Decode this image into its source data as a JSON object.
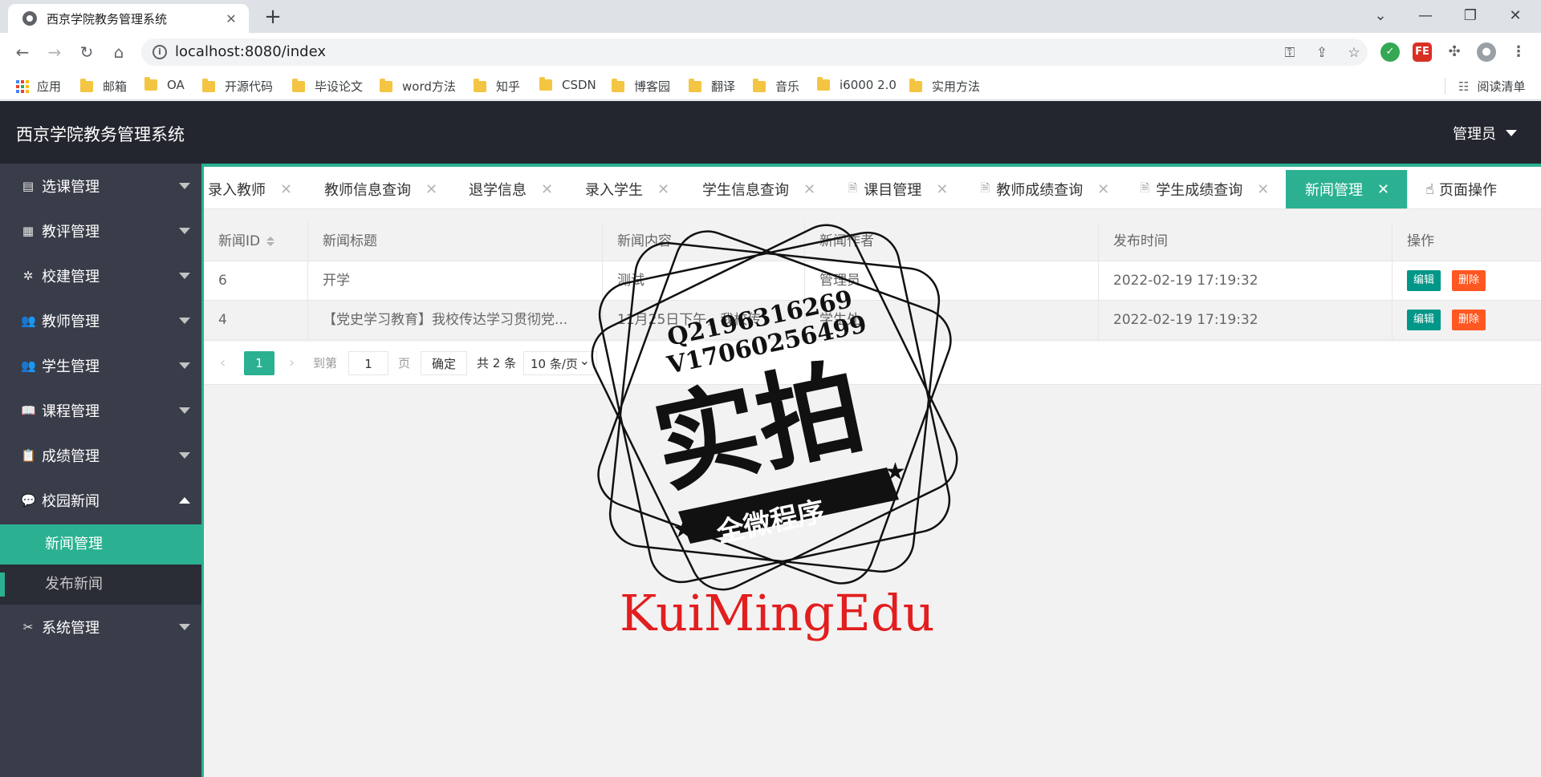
{
  "browser": {
    "tab_title": "西京学院教务管理系统",
    "url": "localhost:8080/index",
    "bookmarks": [
      "应用",
      "邮箱",
      "OA",
      "开源代码",
      "毕设论文",
      "word方法",
      "知乎",
      "CSDN",
      "博客园",
      "翻译",
      "音乐",
      "i6000 2.0",
      "实用方法"
    ],
    "reading_list": "阅读清单",
    "ext_fe": "FE"
  },
  "header": {
    "title": "西京学院教务管理系统",
    "user": "管理员"
  },
  "sidebar": {
    "items": [
      {
        "label": "选课管理"
      },
      {
        "label": "教评管理"
      },
      {
        "label": "校建管理"
      },
      {
        "label": "教师管理"
      },
      {
        "label": "学生管理"
      },
      {
        "label": "课程管理"
      },
      {
        "label": "成绩管理"
      },
      {
        "label": "校园新闻"
      },
      {
        "label": "系统管理"
      }
    ],
    "sub_items": [
      "新闻管理",
      "发布新闻"
    ]
  },
  "page_tabs": [
    "录入教师",
    "教师信息查询",
    "退学信息",
    "录入学生",
    "学生信息查询",
    "课目管理",
    "教师成绩查询",
    "学生成绩查询",
    "新闻管理"
  ],
  "page_op": "页面操作",
  "table": {
    "headers": [
      "新闻ID",
      "新闻标题",
      "新闻内容",
      "新闻作者",
      "发布时间",
      "操作"
    ],
    "rows": [
      {
        "id": "6",
        "title": "开学",
        "content": "测试",
        "author": "管理员",
        "time": "2022-02-19 17:19:32"
      },
      {
        "id": "4",
        "title": "【党史学习教育】我校传达学习贯彻党...",
        "content": "11月25日下午，我校传",
        "author": "学生处",
        "time": "2022-02-19 17:19:32"
      }
    ],
    "edit_label": "编辑",
    "delete_label": "删除"
  },
  "pager": {
    "current": "1",
    "goto_label": "到第",
    "page_input": "1",
    "page_unit": "页",
    "confirm": "确定",
    "total": "共 2 条",
    "page_size": "10 条/页"
  },
  "watermark": {
    "line1": "Q2196316269",
    "line2": "V17060256499",
    "big": "实拍",
    "banner": "全微程序",
    "brand": "KuiMingEdu"
  },
  "colors": {
    "accent": "#2bb191",
    "header_bg": "#23262e",
    "sidebar_bg": "#393d49",
    "danger": "#ff5722"
  }
}
